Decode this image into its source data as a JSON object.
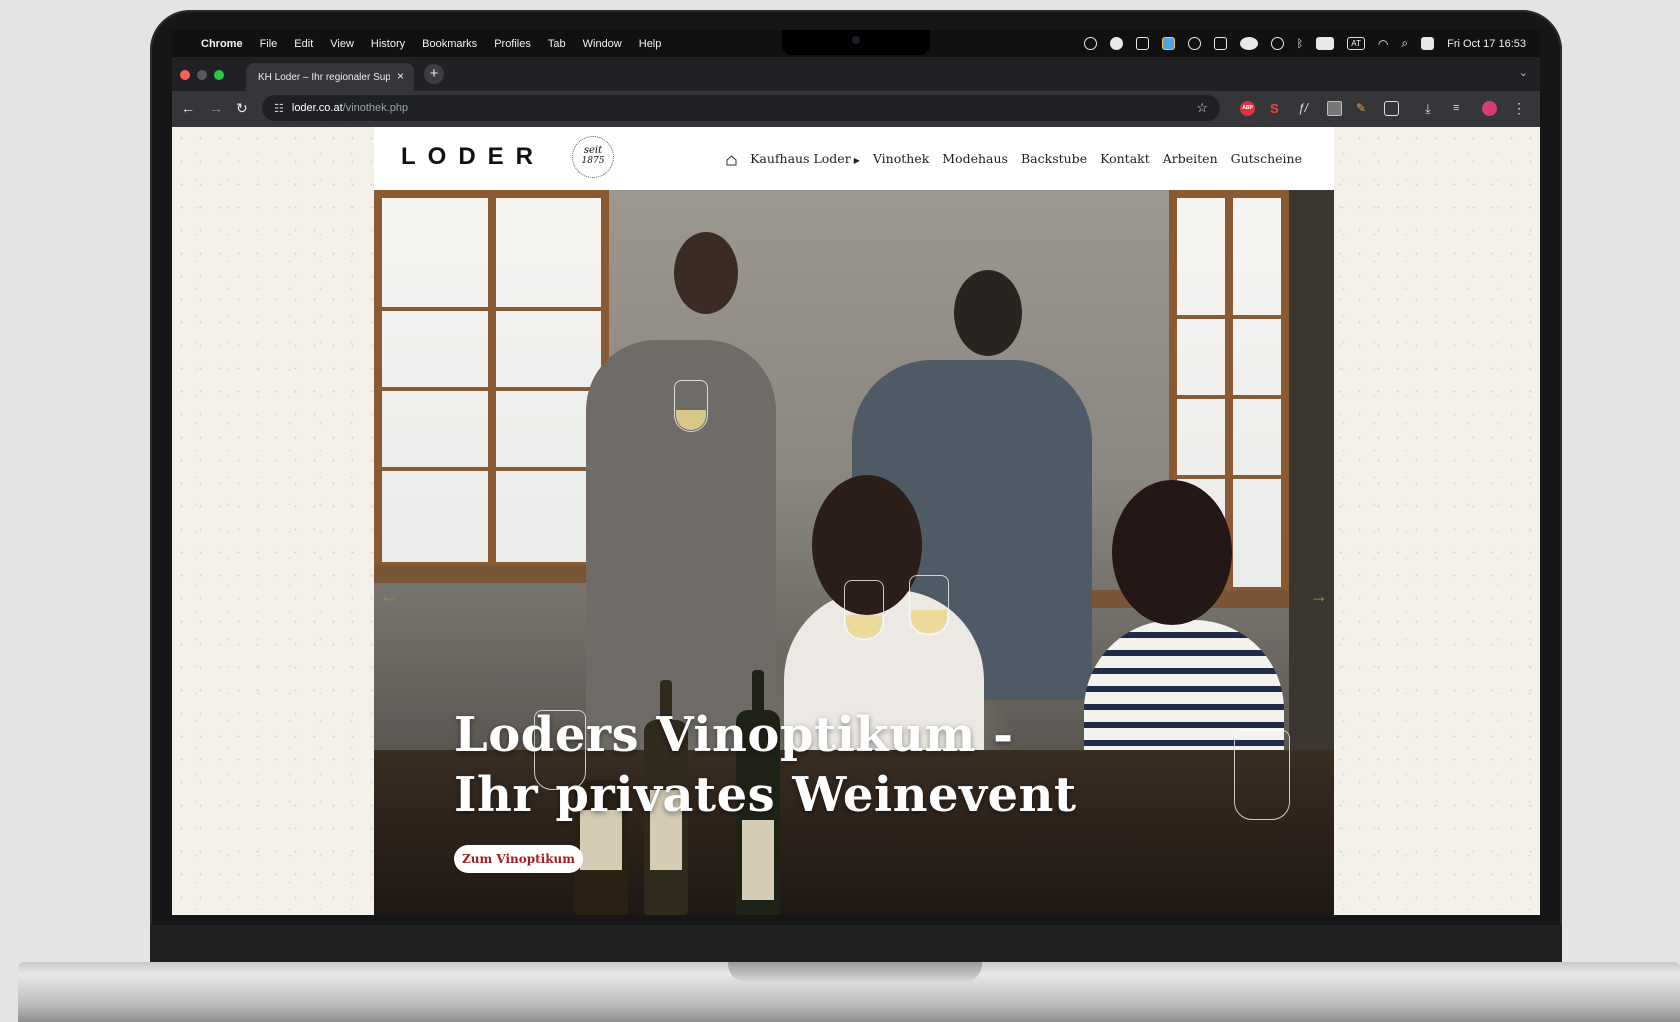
{
  "menubar": {
    "app": "Chrome",
    "items": [
      "File",
      "Edit",
      "View",
      "History",
      "Bookmarks",
      "Profiles",
      "Tab",
      "Window",
      "Help"
    ],
    "input_source": "AT",
    "datetime": "Fri Oct 17  16:53"
  },
  "browser": {
    "tab_title": "KH Loder – Ihr regionaler Supermarkt",
    "tab_close": "×",
    "new_tab": "+",
    "url_host": "loder.co.at",
    "url_path": "/vinothek.php",
    "extensions": {
      "abp": "ABP",
      "s": "S",
      "fx": "ƒ/"
    }
  },
  "site": {
    "logo": "LODER",
    "seal": {
      "line1": "seit",
      "line2": "1875"
    },
    "nav": [
      {
        "label": "Kaufhaus Loder",
        "has_dropdown": true
      },
      {
        "label": "Vinothek"
      },
      {
        "label": "Modehaus"
      },
      {
        "label": "Backstube"
      },
      {
        "label": "Kontakt"
      },
      {
        "label": "Arbeiten"
      },
      {
        "label": "Gutscheine"
      }
    ],
    "hero": {
      "title_line1": "Loders Vinoptikum -",
      "title_line2": "Ihr privates Weinevent",
      "cta": "Zum Vinoptikum",
      "prev_arrow": "←",
      "next_arrow": "→"
    }
  },
  "colors": {
    "cta_text": "#a31f1f",
    "slider_arrows": "#7ca43c",
    "page_bg": "#f4f0ea"
  }
}
